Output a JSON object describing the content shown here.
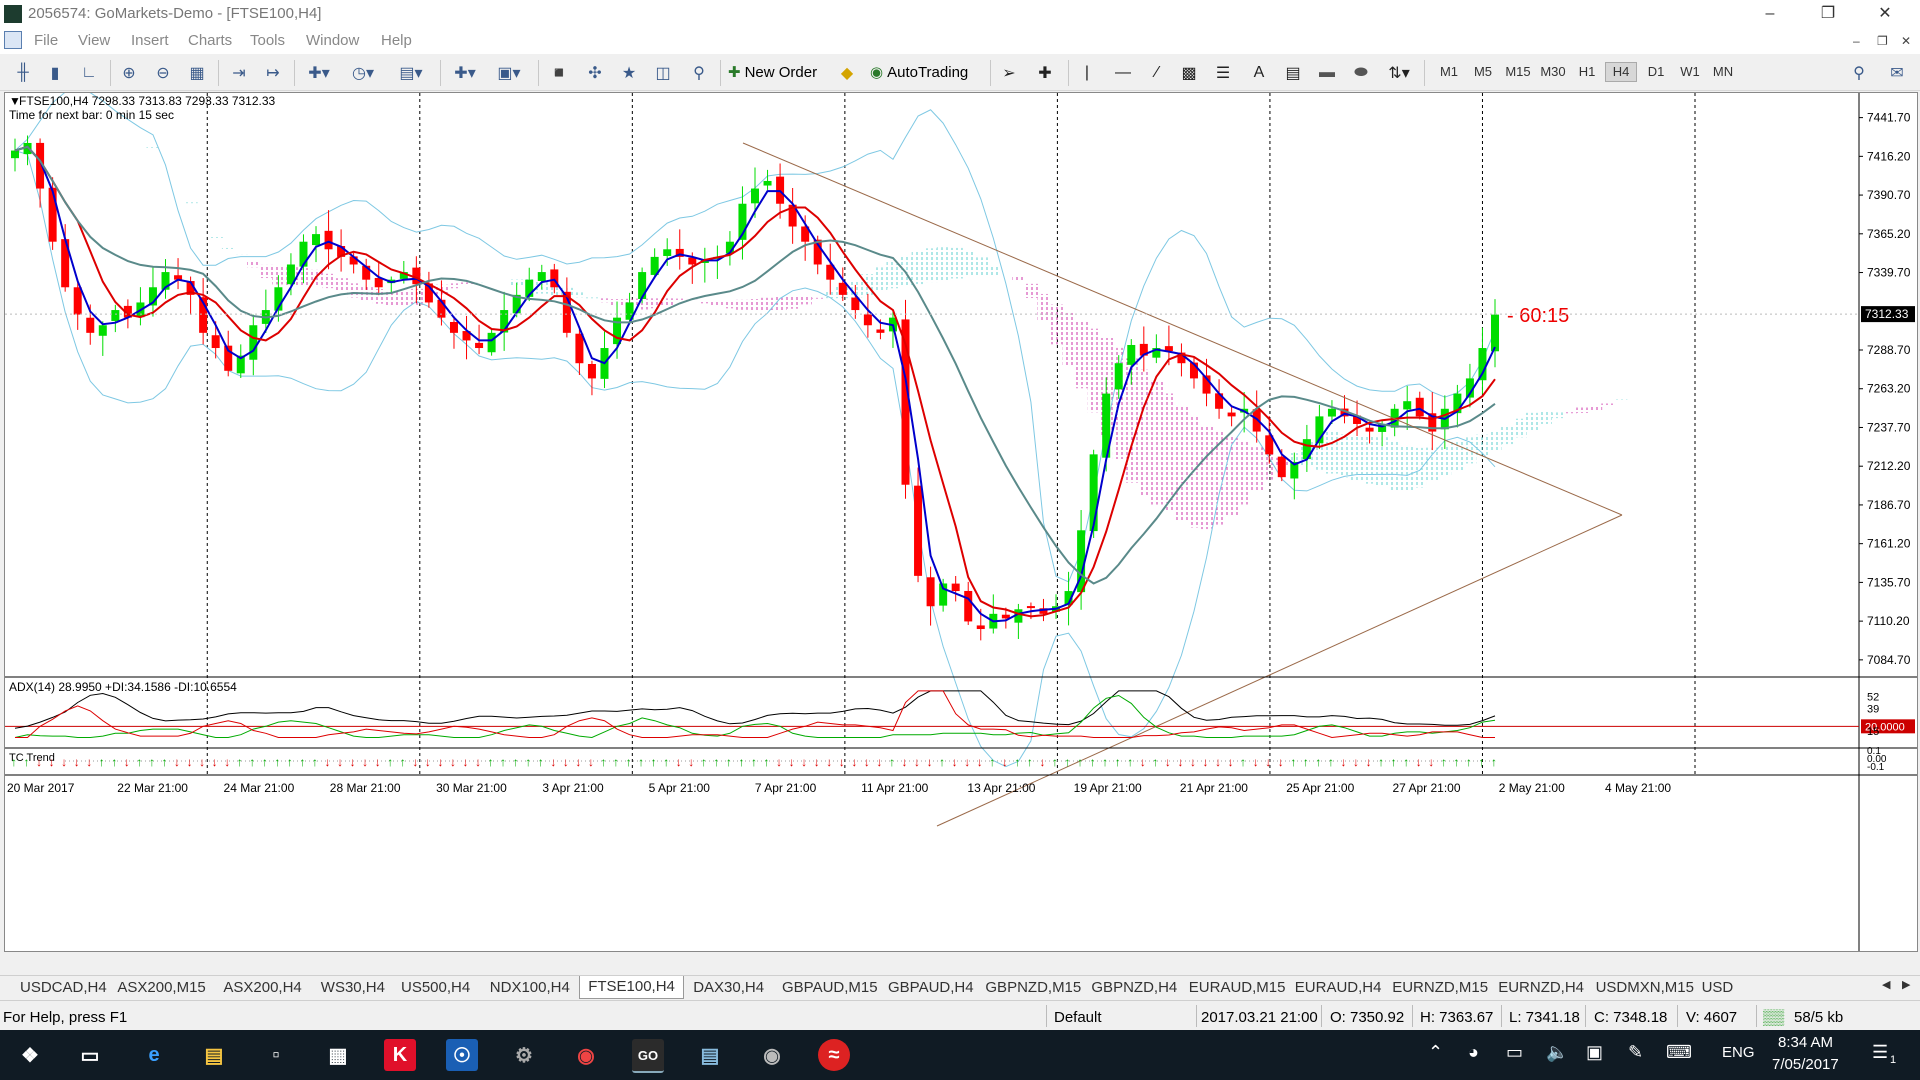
{
  "window": {
    "title": "2056574: GoMarkets-Demo - [FTSE100,H4]"
  },
  "menu": [
    "File",
    "View",
    "Insert",
    "Charts",
    "Tools",
    "Window",
    "Help"
  ],
  "toolbar": {
    "new_order": "New Order",
    "autotrading": "AutoTrading",
    "timeframes": [
      "M1",
      "M5",
      "M15",
      "M30",
      "H1",
      "H4",
      "D1",
      "W1",
      "MN"
    ],
    "active_timeframe": "H4"
  },
  "chart": {
    "header": "FTSE100,H4  7298.33 7313.83 7293.33 7312.33",
    "next_bar": "Time for next bar: 0 min 15 sec",
    "countdown_label": "- 60:15",
    "price_labels": [
      "7441.70",
      "7416.20",
      "7390.70",
      "7365.20",
      "7339.70",
      "7312.33",
      "7288.70",
      "7263.20",
      "7237.70",
      "7212.20",
      "7186.70",
      "7161.20",
      "7135.70",
      "7110.20",
      "7084.70"
    ],
    "current_price": "7312.33",
    "adx_header": "ADX(14) 28.9950 +DI:34.1586 -DI:10.6554",
    "adx_labels": [
      "52",
      "39",
      "20.0000",
      "15"
    ],
    "tc_label": "TC Trend",
    "tc_labels": [
      "0.1",
      "0.00",
      "-0.1"
    ],
    "date_labels": [
      "20 Mar 2017",
      "22 Mar 21:00",
      "24 Mar 21:00",
      "28 Mar 21:00",
      "30 Mar 21:00",
      "3 Apr 21:00",
      "5 Apr 21:00",
      "7 Apr 21:00",
      "11 Apr 21:00",
      "13 Apr 21:00",
      "19 Apr 21:00",
      "21 Apr 21:00",
      "25 Apr 21:00",
      "27 Apr 21:00",
      "2 May 21:00",
      "4 May 21:00"
    ],
    "colors": {
      "bull": "#00dd00",
      "bear": "#ff0000",
      "ma_fast": "#0000cc",
      "ma_mid": "#dd0000",
      "ma_slow": "#5a8a8a",
      "bands": "#7ec8e3",
      "trendline": "#9b6a4a",
      "cloud_up": "#5ecfcf",
      "cloud_down": "#cc33aa"
    }
  },
  "chart_data": {
    "type": "candlestick",
    "symbol": "FTSE100",
    "timeframe": "H4",
    "ylim": [
      7080,
      7450
    ],
    "last": {
      "open": 7298.33,
      "high": 7313.83,
      "low": 7293.33,
      "close": 7312.33
    },
    "closes": [
      7420,
      7425,
      7395,
      7360,
      7330,
      7312,
      7300,
      7305,
      7315,
      7310,
      7320,
      7330,
      7340,
      7335,
      7325,
      7300,
      7290,
      7275,
      7285,
      7305,
      7315,
      7330,
      7345,
      7360,
      7365,
      7355,
      7350,
      7345,
      7335,
      7330,
      7335,
      7340,
      7332,
      7320,
      7310,
      7300,
      7295,
      7290,
      7300,
      7315,
      7325,
      7335,
      7340,
      7330,
      7300,
      7280,
      7270,
      7290,
      7310,
      7320,
      7340,
      7350,
      7355,
      7350,
      7345,
      7348,
      7350,
      7360,
      7385,
      7395,
      7400,
      7385,
      7370,
      7360,
      7345,
      7335,
      7325,
      7315,
      7305,
      7300,
      7310,
      7200,
      7140,
      7120,
      7135,
      7130,
      7110,
      7105,
      7115,
      7112,
      7118,
      7120,
      7115,
      7120,
      7130,
      7170,
      7220,
      7260,
      7280,
      7292,
      7285,
      7290,
      7288,
      7280,
      7270,
      7260,
      7250,
      7245,
      7250,
      7235,
      7220,
      7205,
      7215,
      7230,
      7245,
      7250,
      7245,
      7240,
      7235,
      7240,
      7250,
      7255,
      7245,
      7235,
      7250,
      7260,
      7270,
      7290,
      7312
    ],
    "adx": {
      "adx": 28.995,
      "plus_di": 34.1586,
      "minus_di": 10.6554,
      "level": 20
    },
    "ohlc_status": {
      "time": "2017.03.21 21:00",
      "open": 7350.92,
      "high": 7363.67,
      "low": 7341.18,
      "close": 7348.18,
      "volume": 4607
    }
  },
  "tabs": [
    "USDCAD,H4",
    "ASX200,M15",
    "ASX200,H4",
    "WS30,H4",
    "US500,H4",
    "NDX100,H4",
    "FTSE100,H4",
    "DAX30,H4",
    "GBPAUD,M15",
    "GBPAUD,H4",
    "GBPNZD,M15",
    "GBPNZD,H4",
    "EURAUD,M15",
    "EURAUD,H4",
    "EURNZD,M15",
    "EURNZD,H4",
    "USDMXN,M15",
    "USD"
  ],
  "active_tab": "FTSE100,H4",
  "status": {
    "help": "For Help, press F1",
    "profile": "Default",
    "time": "2017.03.21 21:00",
    "open": "O: 7350.92",
    "high": "H: 7363.67",
    "low": "L: 7341.18",
    "close": "C: 7348.18",
    "volume": "V: 4607",
    "connection": "58/5 kb"
  },
  "taskbar": {
    "lang": "ENG",
    "time": "8:34 AM",
    "date": "7/05/2017",
    "notifications": "1"
  }
}
